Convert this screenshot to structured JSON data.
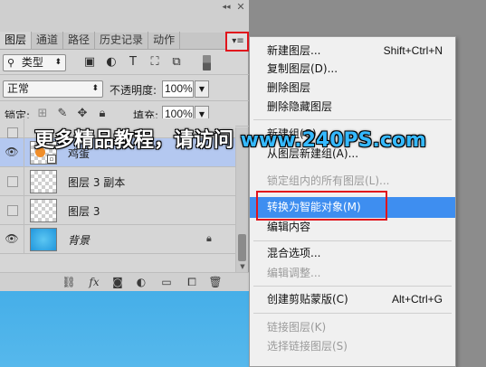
{
  "panel": {
    "collapse": "◂◂",
    "close": "✕",
    "tabs": [
      "图层",
      "通道",
      "路径",
      "历史记录",
      "动作"
    ],
    "menu_icon": "▾≡",
    "filter": {
      "label": "类型",
      "icon": "search-icon",
      "icons": [
        "image-filter-icon",
        "adjustment-filter-icon",
        "type-filter-icon",
        "shape-filter-icon",
        "smart-object-filter-icon"
      ]
    },
    "blend_mode": "正常",
    "opacity_label": "不透明度:",
    "opacity_value": "100%",
    "lock_label": "锁定:",
    "fill_label": "填充:",
    "fill_value": "100%",
    "layers": [
      {
        "name": "",
        "visible": false,
        "selected": false
      },
      {
        "name": "鸡蛋",
        "visible": true,
        "selected": true,
        "smart_object": true
      },
      {
        "name": "图层 3 副本",
        "visible": false,
        "selected": false
      },
      {
        "name": "图层 3",
        "visible": false,
        "selected": false
      },
      {
        "name": "背景",
        "visible": true,
        "selected": false,
        "locked": true
      }
    ],
    "footer_icons": [
      "link-icon",
      "fx-icon",
      "add-mask-icon",
      "adjustment-layer-icon",
      "new-group-icon",
      "new-layer-icon",
      "trash-icon"
    ]
  },
  "menu": {
    "items": [
      {
        "label": "新建图层...",
        "shortcut": "Shift+Ctrl+N",
        "disabled": false
      },
      {
        "label": "复制图层(D)...",
        "shortcut": "",
        "disabled": false
      },
      {
        "label": "删除图层",
        "shortcut": "",
        "disabled": false
      },
      {
        "label": "删除隐藏图层",
        "shortcut": "",
        "disabled": false
      },
      {
        "label": "新建组(G)...",
        "shortcut": "",
        "disabled": false
      },
      {
        "label": "从图层新建组(A)...",
        "shortcut": "",
        "disabled": false
      },
      {
        "label": "锁定组内的所有图层(L)...",
        "shortcut": "",
        "disabled": true
      },
      {
        "label": "转换为智能对象(M)",
        "shortcut": "",
        "disabled": false,
        "highlighted": true
      },
      {
        "label": "编辑内容",
        "shortcut": "",
        "disabled": false
      },
      {
        "label": "混合选项...",
        "shortcut": "",
        "disabled": false
      },
      {
        "label": "编辑调整...",
        "shortcut": "",
        "disabled": true
      },
      {
        "label": "创建剪贴蒙版(C)",
        "shortcut": "Alt+Ctrl+G",
        "disabled": false
      },
      {
        "label": "链接图层(K)",
        "shortcut": "",
        "disabled": true
      },
      {
        "label": "选择链接图层(S)",
        "shortcut": "",
        "disabled": true
      }
    ]
  },
  "watermark": {
    "text_cn": "更多精品教程，请访问 ",
    "url": "www.240PS.com"
  },
  "colors": {
    "highlight": "#3e8ef0",
    "selected_layer": "#b4c8f0",
    "red_outline": "#e1141c",
    "watermark_url": "#35b9ff"
  }
}
